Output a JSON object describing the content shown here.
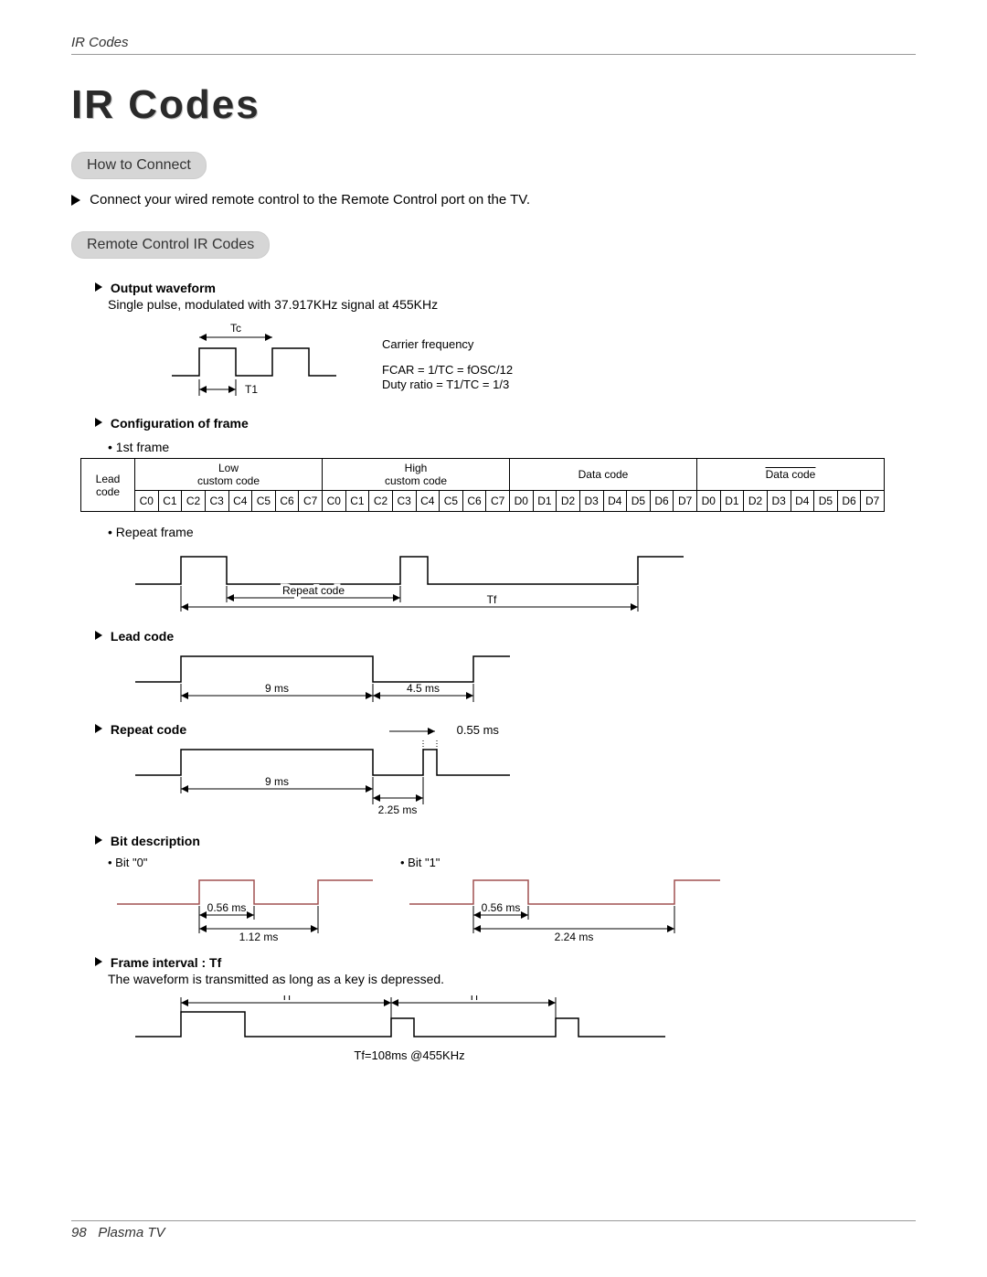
{
  "header_label": "IR Codes",
  "title": "IR Codes",
  "section_connect": "How to Connect",
  "connect_body": "Connect your wired remote control to the Remote Control port on the TV.",
  "section_remote": "Remote Control IR Codes",
  "output_waveform": {
    "heading": "Output waveform",
    "line": "Single pulse, modulated with 37.917KHz signal at 455KHz",
    "tc": "Tc",
    "t1": "T1",
    "carrier": "Carrier frequency",
    "fcar": "FCAR = 1/TC = fOSC/12",
    "duty": "Duty ratio = T1/TC = 1/3"
  },
  "config": {
    "heading": "Configuration of frame",
    "first_frame": "1st frame",
    "headers": [
      "Lead code",
      "Low custom code",
      "High custom code",
      "Data code",
      "Data code"
    ],
    "cells_groups": [
      [
        "C0",
        "C1",
        "C2",
        "C3",
        "C4",
        "C5",
        "C6",
        "C7"
      ],
      [
        "C0",
        "C1",
        "C2",
        "C3",
        "C4",
        "C5",
        "C6",
        "C7"
      ],
      [
        "D0",
        "D1",
        "D2",
        "D3",
        "D4",
        "D5",
        "D6",
        "D7"
      ],
      [
        "D0",
        "D1",
        "D2",
        "D3",
        "D4",
        "D5",
        "D6",
        "D7"
      ]
    ],
    "repeat_frame": "Repeat frame",
    "repeat_code_label": "Repeat code",
    "tf_label": "Tf"
  },
  "lead_code": {
    "heading": "Lead code",
    "t9": "9 ms",
    "t45": "4.5 ms"
  },
  "repeat_code": {
    "heading": "Repeat code",
    "t055": "0.55 ms",
    "t9": "9 ms",
    "t225": "2.25 ms"
  },
  "bit_desc": {
    "heading": "Bit description",
    "bit0": "Bit \"0\"",
    "bit1": "Bit \"1\"",
    "t056a": "0.56 ms",
    "t056b": "0.56 ms",
    "t112": "1.12 ms",
    "t224": "2.24 ms"
  },
  "frame_interval": {
    "heading": "Frame interval : Tf",
    "line": "The waveform is transmitted as long as a key is depressed.",
    "tf": "Tf",
    "bottom": "Tf=108ms @455KHz"
  },
  "footer_page": "98",
  "footer_text": "Plasma TV"
}
